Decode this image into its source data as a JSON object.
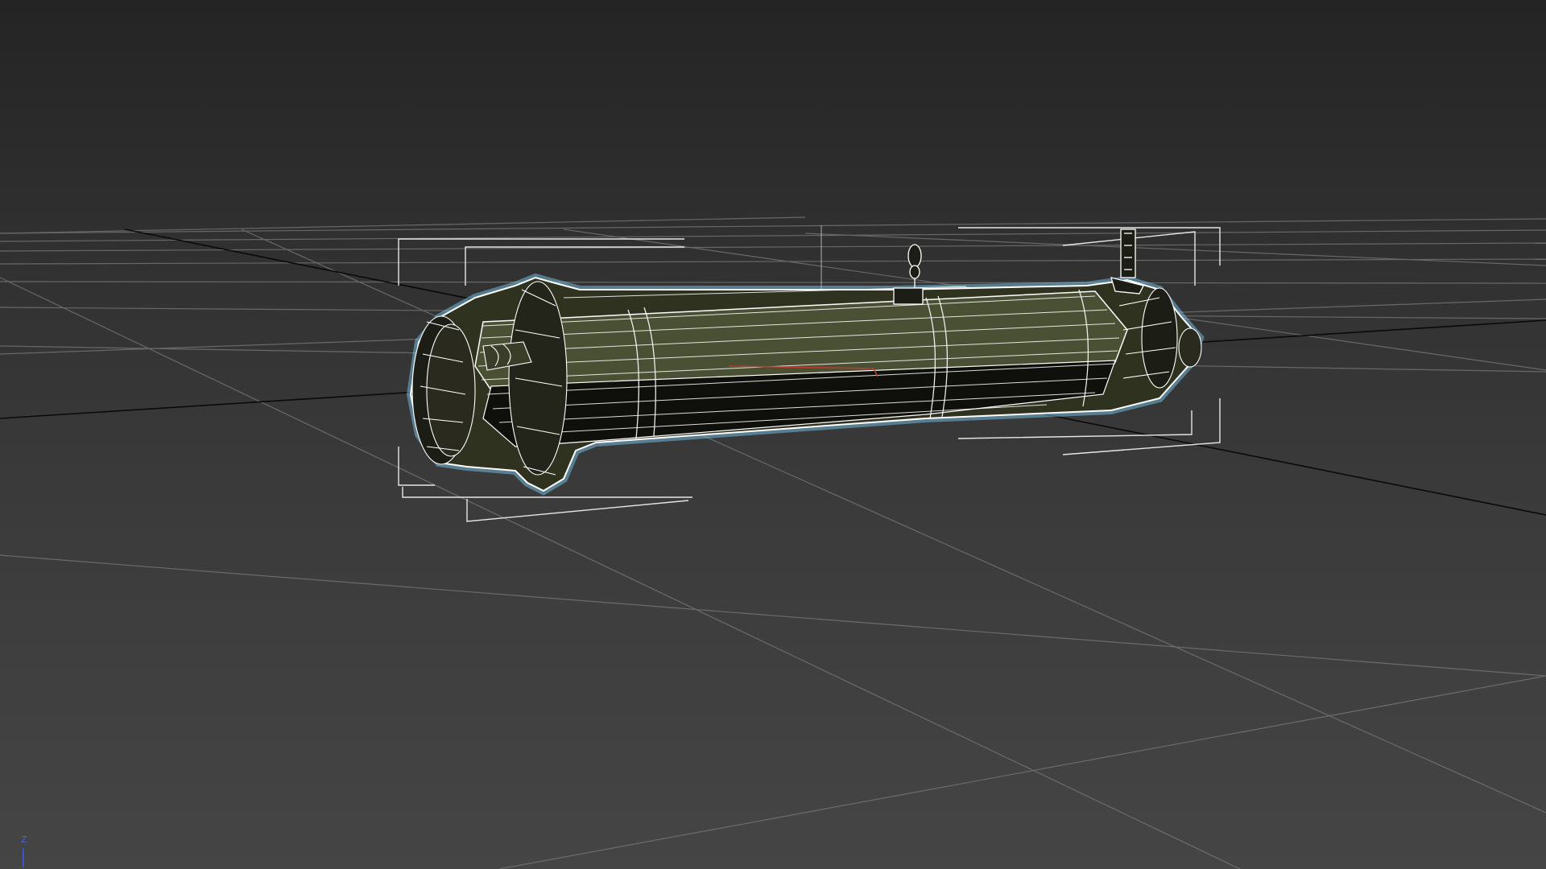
{
  "viewport": {
    "background_top": "#242424",
    "background_bottom": "#454545",
    "grid_color": "#7a7a7a",
    "world_axis_color": "#0a0a0a",
    "selection_outline_color": "#7fd6ff",
    "wireframe_color": "#ffffff",
    "mesh_fill_color": "#4a5034",
    "bounding_box_color": "#e6e6e6",
    "pivot_marker_color": "#c0392b"
  },
  "axis_gizmo": {
    "label": "Z",
    "color": "#3a52d0"
  },
  "object": {
    "type": "launcher-tube",
    "selected": true
  }
}
